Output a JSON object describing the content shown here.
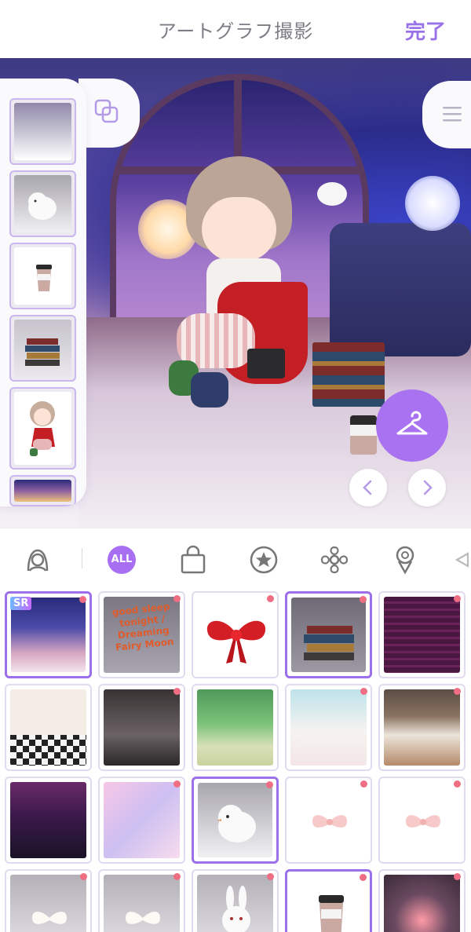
{
  "header": {
    "title": "アートグラフ撮影",
    "done_label": "完了"
  },
  "colors": {
    "accent": "#a872f0",
    "selected_border": "#9b70e8",
    "new_dot": "#f06e84"
  },
  "thumbnails": [
    {
      "name": "background-gradient",
      "icon": "gradient-swatch"
    },
    {
      "name": "white-bird",
      "icon": "bird-icon"
    },
    {
      "name": "coffee-cup",
      "icon": "cup-icon"
    },
    {
      "name": "book-stack",
      "icon": "books-icon"
    },
    {
      "name": "character",
      "icon": "character-icon"
    },
    {
      "name": "room-background",
      "icon": "room-icon"
    }
  ],
  "categories": [
    {
      "name": "avatar",
      "icon": "avatar-icon"
    },
    {
      "name": "all",
      "label": "ALL"
    },
    {
      "name": "bag",
      "icon": "bag-icon"
    },
    {
      "name": "star",
      "icon": "star-icon"
    },
    {
      "name": "flower",
      "icon": "flower-icon"
    },
    {
      "name": "bouquet",
      "icon": "bouquet-icon"
    },
    {
      "name": "more",
      "icon": "ribbon-icon"
    }
  ],
  "grid_items": [
    {
      "name": "night-attic-room",
      "badge": "SR",
      "selected": true
    },
    {
      "name": "goodsleep-text",
      "caption": "good sleep tonight / Dreaming Fairy Moon",
      "selected": false
    },
    {
      "name": "red-bow",
      "selected": false
    },
    {
      "name": "book-stack-item",
      "selected": true
    },
    {
      "name": "neon-purple-room",
      "selected": false
    },
    {
      "name": "white-checker-hall",
      "selected": false
    },
    {
      "name": "dark-dresser-room",
      "selected": false
    },
    {
      "name": "green-park",
      "selected": false
    },
    {
      "name": "bright-window-room",
      "selected": false
    },
    {
      "name": "cafe-storefront",
      "selected": false
    },
    {
      "name": "night-city-window",
      "selected": false
    },
    {
      "name": "pastel-gradient",
      "selected": false
    },
    {
      "name": "white-bird-item",
      "selected": true
    },
    {
      "name": "pink-bow-1",
      "selected": false
    },
    {
      "name": "pink-bow-2",
      "selected": false
    },
    {
      "name": "white-bow-1",
      "selected": false
    },
    {
      "name": "white-bow-2",
      "selected": false
    },
    {
      "name": "white-rabbit",
      "selected": false
    },
    {
      "name": "coffee-cup-item",
      "selected": true
    },
    {
      "name": "candle-light",
      "selected": false
    }
  ]
}
